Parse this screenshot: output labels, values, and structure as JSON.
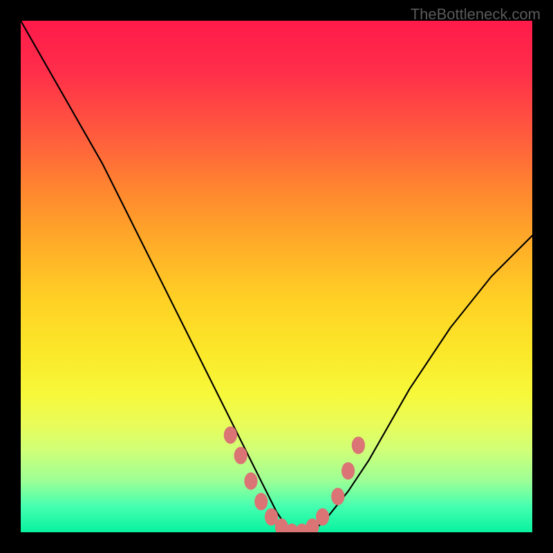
{
  "watermark": "TheBottleneck.com",
  "colors": {
    "frame_bg": "#000000",
    "curve": "#000000",
    "markers": "#db7575",
    "gradient_top": "#ff1a4a",
    "gradient_bottom": "#08f2a0"
  },
  "chart_data": {
    "type": "line",
    "title": "",
    "xlabel": "",
    "ylabel": "",
    "xlim": [
      0,
      100
    ],
    "ylim": [
      0,
      100
    ],
    "axes_visible": false,
    "grid": false,
    "legend": false,
    "series": [
      {
        "name": "bottleneck-curve",
        "x": [
          0,
          4,
          8,
          12,
          16,
          20,
          24,
          28,
          32,
          36,
          40,
          44,
          48,
          50,
          52,
          54,
          56,
          58,
          60,
          64,
          68,
          72,
          76,
          80,
          84,
          88,
          92,
          96,
          100
        ],
        "y": [
          100,
          93,
          86,
          79,
          72,
          64,
          56,
          48,
          40,
          32,
          24,
          16,
          8,
          4,
          1,
          0,
          0,
          1,
          3,
          8,
          14,
          21,
          28,
          34,
          40,
          45,
          50,
          54,
          58
        ]
      }
    ],
    "markers": {
      "name": "highlighted-points",
      "x": [
        41,
        43,
        45,
        47,
        49,
        51,
        53,
        55,
        57,
        59,
        62,
        64,
        66
      ],
      "y": [
        19,
        15,
        10,
        6,
        3,
        1,
        0,
        0,
        1,
        3,
        7,
        12,
        17
      ]
    },
    "background_gradient_semantic": "red (high bottleneck) at top to green (low bottleneck) at bottom"
  }
}
